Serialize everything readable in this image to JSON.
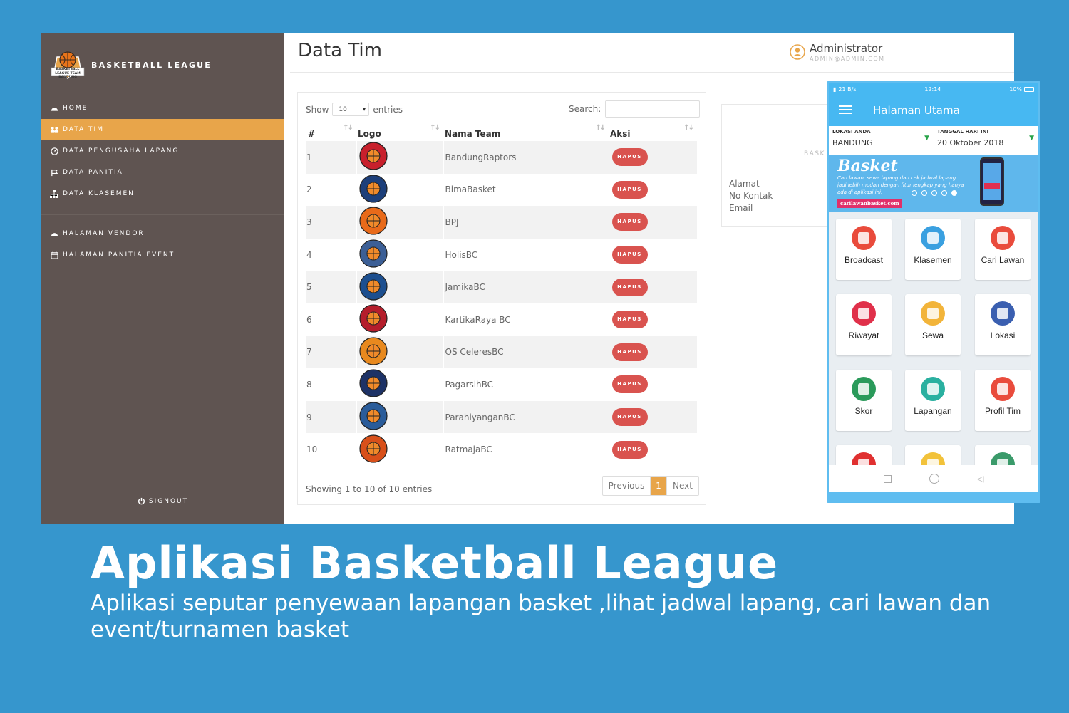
{
  "sidebar": {
    "brand": "BASKETBALL LEAGUE",
    "logo_caption": "BASKETBALL LEAGUE TEAM BANDUNG",
    "menu_primary": [
      {
        "label": "HOME",
        "icon": "dashboard-icon",
        "active": false
      },
      {
        "label": "DATA TIM",
        "icon": "users-icon",
        "active": true
      },
      {
        "label": "DATA PENGUSAHA LAPANG",
        "icon": "gauge-icon",
        "active": false
      },
      {
        "label": "DATA PANITIA",
        "icon": "flag-icon",
        "active": false
      },
      {
        "label": "DATA KLASEMEN",
        "icon": "sitemap-icon",
        "active": false
      }
    ],
    "menu_secondary": [
      {
        "label": "HALAMAN VENDOR",
        "icon": "dashboard-icon"
      },
      {
        "label": "HALAMAN PANITIA EVENT",
        "icon": "calendar-icon"
      }
    ],
    "signout": "SIGNOUT"
  },
  "header": {
    "title": "Data Tim",
    "user_name": "Administrator",
    "user_email": "ADMIN@ADMIN.COM"
  },
  "table": {
    "show_label": "Show",
    "entries_value": "10",
    "entries_label": "entries",
    "search_label": "Search:",
    "search_value": "",
    "columns": [
      "#",
      "Logo",
      "Nama Team",
      "Aksi"
    ],
    "action_label": "HAPUS",
    "rows": [
      {
        "no": "1",
        "name": "BandungRaptors",
        "logo_color": "#c8202c"
      },
      {
        "no": "2",
        "name": "BimaBasket",
        "logo_color": "#1d3f7a"
      },
      {
        "no": "3",
        "name": "BPJ",
        "logo_color": "#e86a1a"
      },
      {
        "no": "4",
        "name": "HolisBC",
        "logo_color": "#3c5f96"
      },
      {
        "no": "5",
        "name": "JamikaBC",
        "logo_color": "#1d4f8f"
      },
      {
        "no": "6",
        "name": "KartikaRaya BC",
        "logo_color": "#b51e2c"
      },
      {
        "no": "7",
        "name": "OS CeleresBC",
        "logo_color": "#e8891e"
      },
      {
        "no": "8",
        "name": "PagarsihBC",
        "logo_color": "#1d3266"
      },
      {
        "no": "9",
        "name": "ParahiyanganBC",
        "logo_color": "#2a5c9a"
      },
      {
        "no": "10",
        "name": "RatmajaBC",
        "logo_color": "#d8501a"
      }
    ],
    "showing": "Showing 1 to 10 of 10 entries",
    "pager": {
      "prev": "Previous",
      "current": "1",
      "next": "Next"
    }
  },
  "detail": {
    "brand_partial": "BASK",
    "labels": [
      "Alamat",
      "No Kontak",
      "Email"
    ]
  },
  "phone": {
    "status_left": "21 B/s",
    "status_time": "12:14",
    "status_right": "10%",
    "app_title": "Halaman Utama",
    "location_label": "LOKASI ANDA",
    "location_value": "BANDUNG",
    "date_label": "TANGGAL HARI INI",
    "date_value": "20 Oktober 2018",
    "banner_title": "Basket",
    "banner_text": "Cari lawan, sewa lapang dan cek jadwal lapang jadi lebih mudah dengan fitur lengkap yang hanya ada di aplikasi ini.",
    "banner_url": "carilawanbasket.com",
    "tiles": [
      {
        "label": "Broadcast",
        "color": "#e94b3c"
      },
      {
        "label": "Klasemen",
        "color": "#3aa0e0"
      },
      {
        "label": "Cari Lawan",
        "color": "#e94b3c"
      },
      {
        "label": "Riwayat",
        "color": "#e0304a"
      },
      {
        "label": "Sewa",
        "color": "#f2b43a"
      },
      {
        "label": "Lokasi",
        "color": "#3a5fb0"
      },
      {
        "label": "Skor",
        "color": "#2a9a5a"
      },
      {
        "label": "Lapangan",
        "color": "#2ab0a0"
      },
      {
        "label": "Profil Tim",
        "color": "#e94b3c"
      },
      {
        "label": "",
        "color": "#e03030"
      },
      {
        "label": "",
        "color": "#f2c23a"
      },
      {
        "label": "",
        "color": "#3a9a6a"
      }
    ]
  },
  "caption": {
    "title": "Aplikasi Basketball League",
    "subtitle": "Aplikasi seputar penyewaan lapangan basket ,lihat jadwal lapang, cari lawan dan event/turnamen basket"
  },
  "colors": {
    "background": "#3696cd",
    "sidebar": "#5f5451",
    "accent": "#e8a54a",
    "danger": "#d9534f",
    "phone_primary": "#47b8f2"
  }
}
